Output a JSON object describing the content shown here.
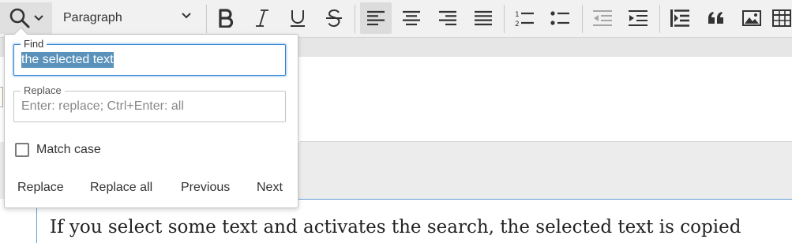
{
  "toolbar": {
    "heading_select": {
      "label": "Paragraph"
    },
    "active_alignment": "align-left",
    "accent_color": "#2f7fd3"
  },
  "find_panel": {
    "find": {
      "label": "Find",
      "value": "the selected text"
    },
    "replace": {
      "label": "Replace",
      "placeholder": "Enter: replace; Ctrl+Enter: all"
    },
    "match_case": {
      "label": "Match case",
      "checked": false
    },
    "actions": {
      "replace": "Replace",
      "replace_all": "Replace all",
      "previous": "Previous",
      "next": "Next"
    }
  },
  "editor": {
    "paragraph": "If you select some text and activates the search, the selected text is copied"
  }
}
